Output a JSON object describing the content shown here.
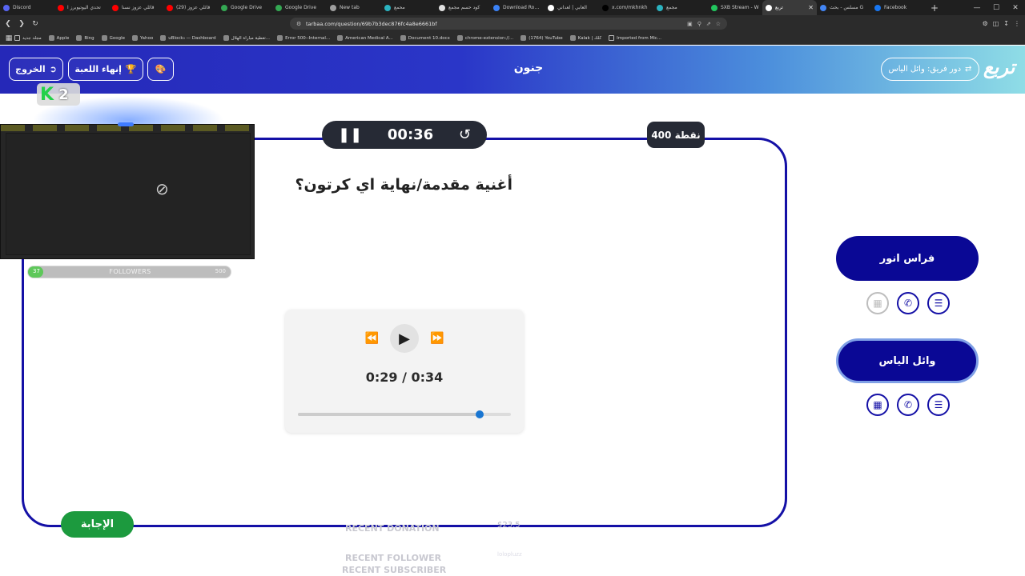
{
  "browser": {
    "tabs": [
      {
        "title": "Discord",
        "color": "#5865f2"
      },
      {
        "title": "تحدي اليوتيوبرز ا",
        "color": "#ff0000"
      },
      {
        "title": "قائلي عزوز نسنا",
        "color": "#ff0000"
      },
      {
        "title": "(29) قائلي عزوز",
        "color": "#ff0000"
      },
      {
        "title": "Google Drive",
        "color": "#34a853"
      },
      {
        "title": "Google Drive",
        "color": "#34a853"
      },
      {
        "title": "New tab",
        "color": "#9e9e9e"
      },
      {
        "title": "محمع",
        "color": "#2bb3c0"
      },
      {
        "title": "كود حسم مجمع",
        "color": "#e0e0e0"
      },
      {
        "title": "Download Roblo",
        "color": "#3b82f6"
      },
      {
        "title": "العابي | لعداني",
        "color": "#ffffff"
      },
      {
        "title": "x.com/mkhnkh",
        "color": "#000000"
      },
      {
        "title": "مجمع",
        "color": "#2bb3c0"
      },
      {
        "title": "SXB Stream - W",
        "color": "#22c55e"
      },
      {
        "title": "تربع",
        "color": "#ffffff",
        "active": true
      },
      {
        "title": "مسلس - بحث G",
        "color": "#4285f4"
      },
      {
        "title": "Facebook",
        "color": "#1877f2"
      }
    ],
    "url": "tarbaa.com/question/69b7b3dec876fc4a8e6661bf",
    "bookmarks": [
      {
        "label": "مجلد جديد",
        "folder": true
      },
      {
        "label": "Apple"
      },
      {
        "label": "Bing"
      },
      {
        "label": "Google"
      },
      {
        "label": "Yahoo"
      },
      {
        "label": "uBlock₀ — Dashboard"
      },
      {
        "label": "تغطية مباراة الهلال..."
      },
      {
        "label": "Error 500--Internal..."
      },
      {
        "label": "American Medical A..."
      },
      {
        "label": "Document 10.docx"
      },
      {
        "label": "chrome-extension://..."
      },
      {
        "label": "(1764) YouTube"
      },
      {
        "label": "Kalak | كلك"
      },
      {
        "label": "Imported from Mic...",
        "folder": true
      }
    ]
  },
  "header": {
    "exit_label": "الخروج",
    "end_game_label": "إنهاء اللعبة",
    "title": "جنون",
    "turn_label": "دور فريق: وائل الياس",
    "logo": "تربع"
  },
  "board": {
    "timer": "00:36",
    "points": "400 نقطة",
    "question": "أغنية مقدمة/نهاية اي كرتون؟",
    "answer_label": "الإجابة"
  },
  "player": {
    "time_display": "0:29 / 0:34",
    "current_seconds": 29,
    "total_seconds": 34
  },
  "teams": [
    {
      "name": "فراس انور",
      "aids_used": [
        true,
        false,
        false
      ]
    },
    {
      "name": "وائل الياس",
      "aids_used": [
        false,
        false,
        false
      ]
    }
  ],
  "stream_overlay": {
    "k_count": "2",
    "followers_label": "FOLLOWERS",
    "followers_current": "37",
    "followers_goal": "500",
    "followers_current_value": 37,
    "followers_goal_value": 500,
    "recent_donation_label": "RECENT DONATION",
    "recent_donation_value": "$23.5",
    "recent_follower_label": "RECENT FOLLOWER",
    "recent_follower_value": "lolopluzz",
    "recent_subscriber_label": "RECENT SUBSCRIBER"
  },
  "colors": {
    "board_border": "#1410a6",
    "team_button": "#0a0895",
    "answer_button": "#1c9a3e",
    "dark_pill": "#262a35",
    "progress_knob": "#1976d2"
  }
}
